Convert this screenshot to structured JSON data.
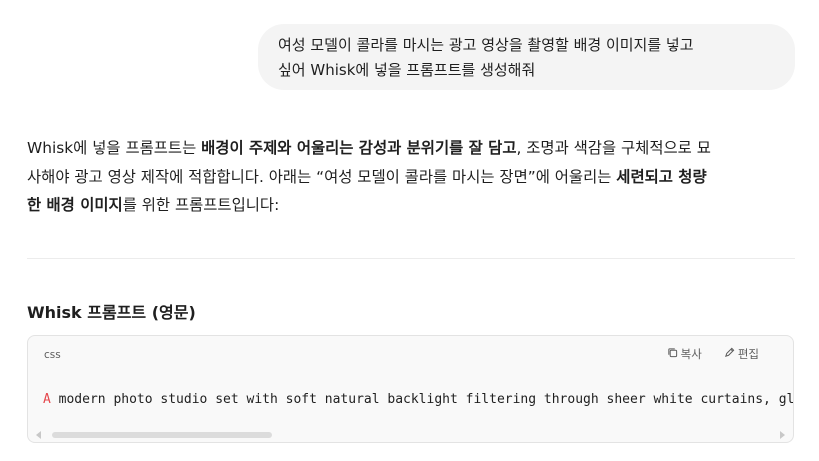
{
  "user_message": {
    "line1": "여성 모델이 콜라를 마시는 광고 영상을 촬영할 배경 이미지를 넣고",
    "line2": "싶어 Whisk에 넣을 프롬프트를 생성해줘"
  },
  "answer": {
    "l1_a": "Whisk에 넣을 프롬프트는 ",
    "l1_b": "배경이 주제와 어울리는 감성과 분위기를 잘 담고",
    "l1_c": ", 조명과 색감을 구체적으로 묘",
    "l2_a": "사해야 광고 영상 제작에 적합합니다. 아래는 “여성 모델이 콜라를 마시는 장면”에 어울리는 ",
    "l2_b": "세련되고 청량",
    "l3_a": "한 배경 이미지",
    "l3_b": "를 위한 프롬프트입니다:"
  },
  "section_title": "Whisk 프롬프트 (영문)",
  "code_block": {
    "language": "css",
    "copy_label": "복사",
    "edit_label": "편집",
    "first_token": "A",
    "code_rest": " modern photo studio set with soft natural backlight filtering through sheer white curtains, glos",
    "first_token_color": "#e5484d"
  },
  "icons": {
    "copy": "copy-icon",
    "edit": "edit-icon"
  }
}
